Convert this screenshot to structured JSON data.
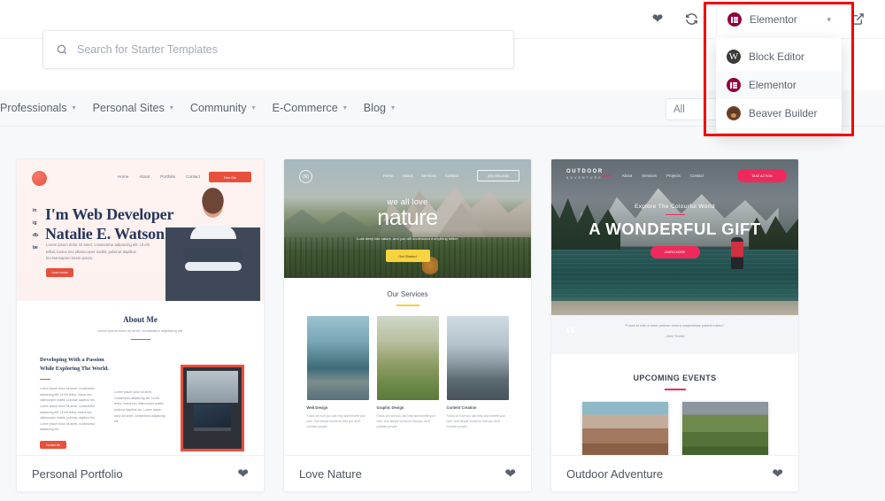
{
  "topbar": {
    "favorites_icon": "heart-icon",
    "sync_icon": "refresh-icon",
    "external_icon": "external-link-icon"
  },
  "search": {
    "placeholder": "Search for Starter Templates",
    "value": "",
    "icon": "search-icon"
  },
  "nav": {
    "items": [
      {
        "label": "Professionals",
        "caret": "▾"
      },
      {
        "label": "Personal Sites",
        "caret": "▾"
      },
      {
        "label": "Community",
        "caret": "▾"
      },
      {
        "label": "E-Commerce",
        "caret": "▾"
      },
      {
        "label": "Blog",
        "caret": "▾"
      }
    ],
    "filter": {
      "label": "All",
      "caret": "▾"
    }
  },
  "builder_dropdown": {
    "selected": "Elementor",
    "caret": "▾",
    "highlight_color": "#f50000",
    "options": [
      {
        "label": "Block Editor",
        "icon": "wordpress-icon",
        "selected": false
      },
      {
        "label": "Elementor",
        "icon": "elementor-icon",
        "selected": true
      },
      {
        "label": "Beaver Builder",
        "icon": "beaver-icon",
        "selected": false
      }
    ]
  },
  "templates": [
    {
      "title": "Personal Portfolio",
      "favorite_icon": "heart-icon",
      "preview": {
        "nav": [
          "Home",
          "About",
          "Portfolio",
          "Contact"
        ],
        "cta": "Hire Me",
        "social": [
          "in",
          "ig",
          "db",
          "be"
        ],
        "heading_line1": "I'm Web Developer",
        "heading_line2": "Natalie E. Watson",
        "paragraph": "Lorem ipsum dolor sit amet, consectetur adipiscing elit. Ut elit tellus, luctus nec ullamcorper mattis, pulvinar dapibus leo.Nonsapien lorem ipsum.",
        "button": "Learn more",
        "about_heading": "About Me",
        "about_sub": "Lorem ipsum dolor sit amet, consectetur adipiscing elit.",
        "sub_heading": "Developing With a Passion While Exploring The World.",
        "col1": "Lorem ipsum dolor sit amet, consectetur adipiscing elit. Ut elit tellus, luctus nec ullamcorper mattis, pulvinar dapibus leo. Lorem ipsum dolor sit amet, consectetur adipiscing elit. Ut elit tellus, luctus nec ullamcorper mattis, pulvinar dapibus leo.  Lorem ipsum dolor sit amet, consectetur adipiscing elit.",
        "col2": "Lorem ipsum dolor sit amet, consectetur adipiscing elit. Ut elit tellus, luctus nec ullamcorper mattis, pulvinar dapibus leo.  Lorem ipsum dolor sit amet, consectetur adipiscing elit.",
        "button2": "Contact Me"
      }
    },
    {
      "title": "Love Nature",
      "favorite_icon": "heart-icon",
      "preview": {
        "logo": "(N)",
        "nav": [
          "Home",
          "About",
          "Services",
          "Contact"
        ],
        "cta": "(00) 000-0000",
        "hero_small": "we all love",
        "hero_big": "nature",
        "hero_desc": "Look deep into nature, and you will understand everything better.",
        "hero_button": "Get Started",
        "section_title": "Our Services",
        "services": [
          {
            "name": "Web Design",
            "desc": "Focus on how you can help and benefit your user. Use simple words so that you don't confuse people."
          },
          {
            "name": "Graphic Design",
            "desc": "Focus on how you can help and benefit your user. Use simple words so that you don't confuse people."
          },
          {
            "name": "Content Creation",
            "desc": "Focus on how you can help and benefit your user. Use simple words so that you don't confuse people."
          }
        ]
      }
    },
    {
      "title": "Outdoor Adventure",
      "favorite_icon": "heart-icon",
      "preview": {
        "logo": "OUTDOOR",
        "logo_sub": "ADVENTURE",
        "nav": [
          "Home",
          "About",
          "Services",
          "Projects",
          "Contact"
        ],
        "cta": "TAKE ACTION",
        "hero_sup": "Explore The Colourful World",
        "hero_title": "A WONDERFUL GIFT",
        "hero_button": "LEARN MORE",
        "quote": "\"Fusce id velit ut tortor pretium viverra suspendisse potenti nullam.\"",
        "quote_author": "- Allen Tendler",
        "events_title": "UPCOMING EVENTS"
      }
    }
  ]
}
